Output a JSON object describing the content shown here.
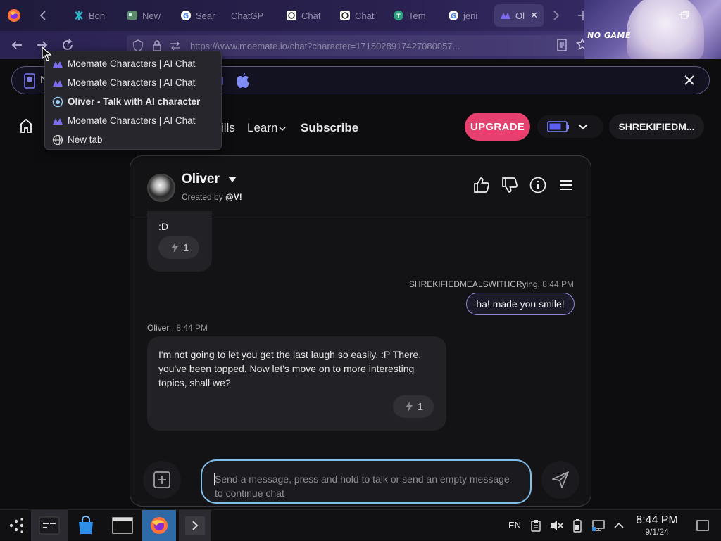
{
  "browser": {
    "tabs": [
      {
        "label": "Bon",
        "icon": "puzzle-icon",
        "color": "#2fb5c8"
      },
      {
        "label": "New",
        "icon": "newtab-icon",
        "color": "#5a8a6a"
      },
      {
        "label": "Sear",
        "icon": "google-icon",
        "color": "#ffffff"
      },
      {
        "label": "ChatGP",
        "icon": "none",
        "color": "#ffffff"
      },
      {
        "label": "Chat",
        "icon": "openai-icon",
        "color": "#ffffff"
      },
      {
        "label": "Chat",
        "icon": "openai-icon",
        "color": "#ffffff"
      },
      {
        "label": "Tem",
        "icon": "template-icon",
        "color": "#2e9e7e"
      },
      {
        "label": "jeni",
        "icon": "google-icon",
        "color": "#ffffff"
      },
      {
        "label": "Ol",
        "icon": "moemate-icon",
        "color": "#7c6cf0",
        "active": true
      }
    ],
    "url": "https://www.moemate.io/chat?character=1715028917427080057...",
    "art_text": "NO GAME",
    "history_menu": [
      {
        "label": "Moemate Characters | AI Chat",
        "icon": "moemate-icon"
      },
      {
        "label": "Moemate Characters | AI Chat",
        "icon": "moemate-icon"
      },
      {
        "label": "Oliver - Talk with AI character",
        "icon": "current-dot-icon",
        "current": true
      },
      {
        "label": "Moemate Characters | AI Chat",
        "icon": "moemate-icon"
      },
      {
        "label": "New tab",
        "icon": "globe-icon"
      }
    ]
  },
  "site": {
    "banner_text": "N",
    "nav": {
      "skills_partial": "ills",
      "learn": "Learn",
      "subscribe": "Subscribe"
    },
    "upgrade_label": "UPGRADE",
    "username": "SHREKIFIEDM...",
    "accent": "#e8406e"
  },
  "chat": {
    "character_name": "Oliver",
    "created_by_prefix": "Created by",
    "created_by_user": "@V!",
    "messages": {
      "first_tail_text": ":D",
      "first_reaction_count": "1",
      "user_meta_name": "SHREKIFIEDMEALSWITHCRying,",
      "user_meta_time": "8:44 PM",
      "user_text": "ha! made you smile!",
      "bot_meta_name": "Oliver ,",
      "bot_meta_time": "8:44 PM",
      "bot_text": "I'm not going to let you get the last laugh so easily. :P There, you've been topped. Now let's move on to more interesting topics, shall we?",
      "bot_reaction_count": "1"
    },
    "compose_placeholder": "Send a message, press and hold to talk or send an empty message to continue chat"
  },
  "taskbar": {
    "language": "EN",
    "time": "8:44 PM",
    "date": "9/1/24"
  }
}
